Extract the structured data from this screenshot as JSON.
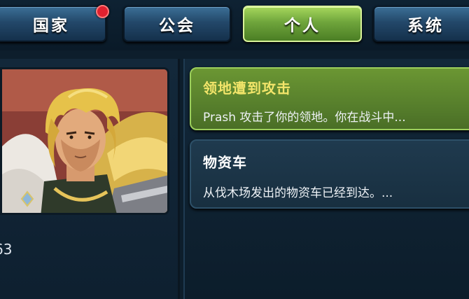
{
  "tabs": [
    {
      "label": "国家",
      "active": false,
      "has_badge": true
    },
    {
      "label": "公会",
      "active": false,
      "has_badge": false
    },
    {
      "label": "个人",
      "active": true,
      "has_badge": false
    },
    {
      "label": "系统",
      "active": false,
      "has_badge": false
    }
  ],
  "left_panel": {
    "stat_text": "63"
  },
  "messages": [
    {
      "title": "领地遭到攻击",
      "body": "Prash 攻击了你的领地。你在战斗中...",
      "state": "unread"
    },
    {
      "title": "物资车",
      "body": "从伐木场发出的物资车已经到达。...",
      "state": "read"
    }
  ],
  "colors": {
    "active_tab": "#6fa53c",
    "tab": "#23486a",
    "unread_title": "#f3e56a",
    "badge": "#e0212f"
  }
}
